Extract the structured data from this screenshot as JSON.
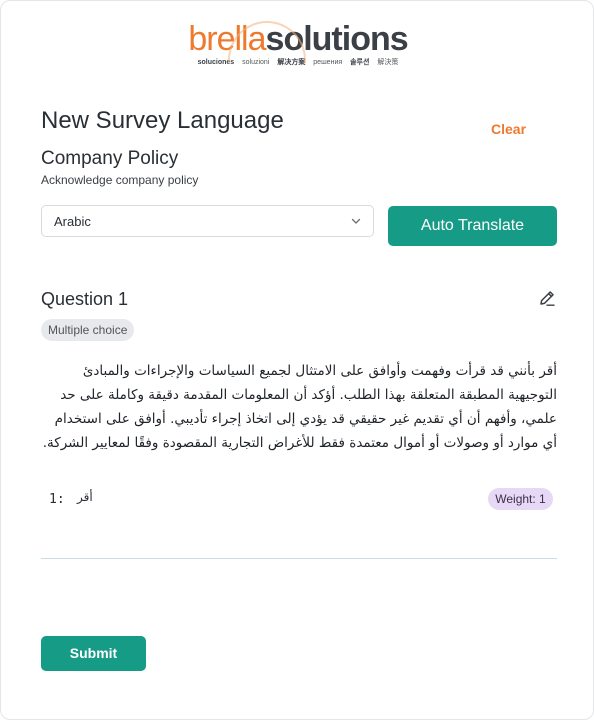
{
  "logo": {
    "part1": "brella",
    "part2": "solutions",
    "tagline": [
      "soluciones",
      "soluzioni",
      "解决方案",
      "решения",
      "솔루션",
      "解決策"
    ]
  },
  "header": {
    "title": "New Survey Language",
    "clear_label": "Clear"
  },
  "policy": {
    "title": "Company Policy",
    "subtitle": "Acknowledge company policy"
  },
  "language": {
    "selected": "Arabic",
    "chevron_icon": "chevron-down-icon",
    "auto_translate_label": "Auto Translate"
  },
  "question": {
    "title": "Question 1",
    "type": "Multiple choice",
    "edit_icon": "edit-icon",
    "text": "أقر بأنني قد قرأت وفهمت وأوافق على الامتثال لجميع السياسات والإجراءات والمبادئ التوجيهية المطبقة المتعلقة بهذا الطلب. أؤكد أن المعلومات المقدمة دقيقة وكاملة على حد علمي، وأفهم أن أي تقديم غير حقيقي قد يؤدي إلى اتخاذ إجراء تأديبي. أوافق على استخدام أي موارد أو وصولات أو أموال معتمدة فقط للأغراض التجارية المقصودة وفقًا لمعايير الشركة.",
    "options": [
      {
        "index": "1:",
        "text": "أقر",
        "weight": "Weight: 1"
      }
    ]
  },
  "footer": {
    "submit_label": "Submit"
  },
  "colors": {
    "accent_teal": "#169b86",
    "accent_orange": "#ee7a2f",
    "weight_badge": "#e7d8f5"
  }
}
